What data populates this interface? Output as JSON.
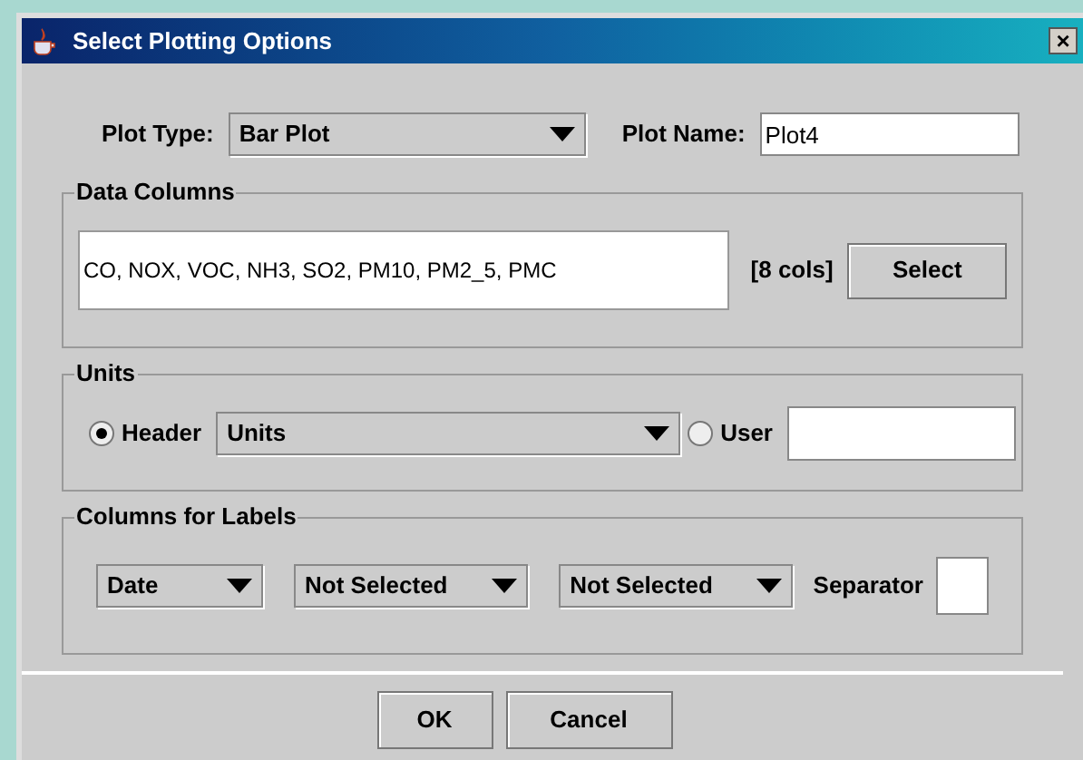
{
  "window": {
    "title": "Select Plotting Options",
    "close": "×"
  },
  "plot_type": {
    "label": "Plot Type:",
    "value": "Bar Plot"
  },
  "plot_name": {
    "label": "Plot Name:",
    "value": "Plot4"
  },
  "data_columns": {
    "title": "Data Columns",
    "value": "CO, NOX, VOC, NH3, SO2, PM10, PM2_5, PMC",
    "count": "[8 cols]",
    "button": "Select"
  },
  "units": {
    "title": "Units",
    "options": [
      {
        "label": "Header",
        "selected": true
      },
      {
        "label": "User",
        "selected": false
      }
    ],
    "header_value": "Units"
  },
  "labels": {
    "title": "Columns for Labels",
    "dropdowns": [
      "Date",
      "Not Selected",
      "Not Selected"
    ],
    "separator_label": "Separator"
  },
  "buttons": [
    "OK",
    "Cancel"
  ]
}
